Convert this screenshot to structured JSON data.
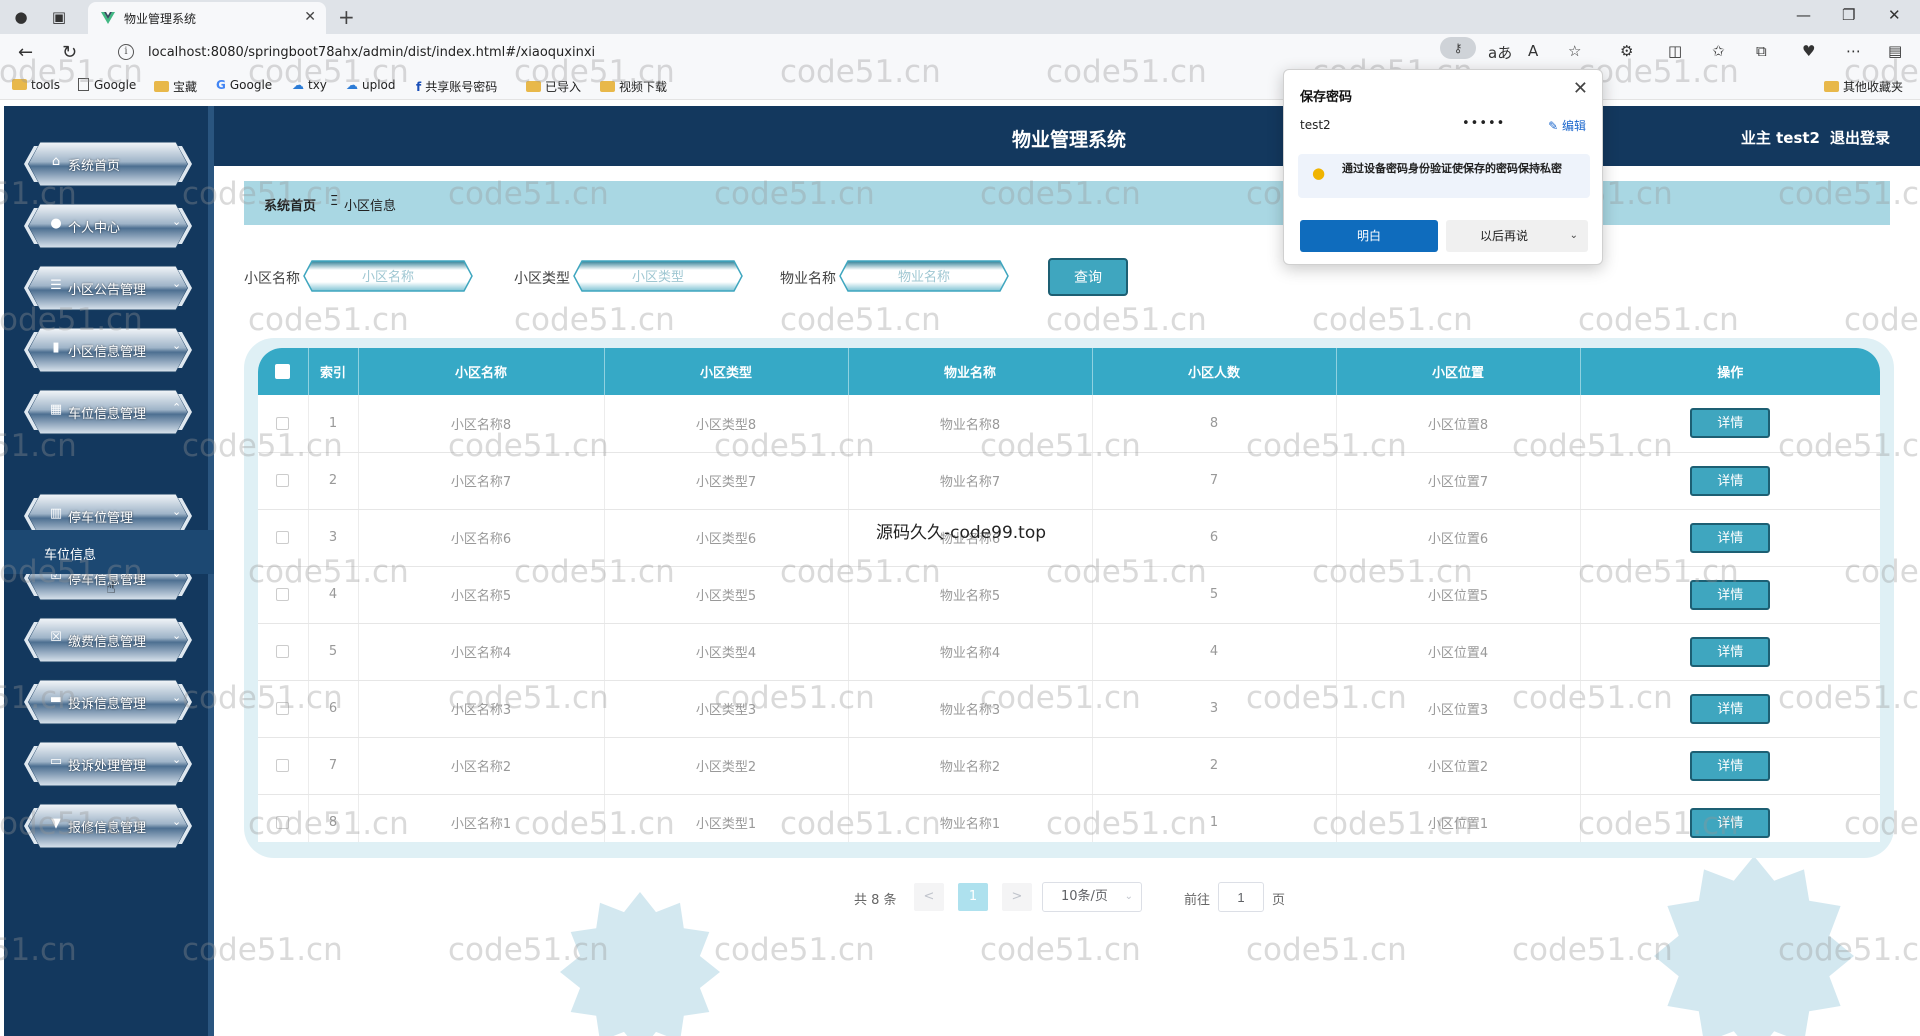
{
  "browser": {
    "tab_title": "物业管理系统",
    "url": "localhost:8080/springboot78ahx/admin/dist/index.html#/xiaoquxinxi",
    "bookmarks": [
      {
        "label": "tools",
        "type": "folder"
      },
      {
        "label": "Google",
        "type": "doc"
      },
      {
        "label": "宝藏",
        "type": "folder"
      },
      {
        "label": "Google",
        "type": "google"
      },
      {
        "label": "txy",
        "type": "cloud"
      },
      {
        "label": "uplod",
        "type": "cloud"
      },
      {
        "label": "共享账号密码",
        "type": "brand"
      },
      {
        "label": "已导入",
        "type": "folder"
      },
      {
        "label": "视频下载",
        "type": "folder"
      }
    ],
    "other_bookmarks": "其他收藏夹"
  },
  "header": {
    "title": "物业管理系统",
    "user_label": "业主 test2",
    "logout_label": "退出登录"
  },
  "sidebar": {
    "items": [
      {
        "label": "系统首页",
        "icon": "home-icon",
        "arrow": ""
      },
      {
        "label": "个人中心",
        "icon": "user-icon",
        "arrow": "⌄"
      },
      {
        "label": "小区公告管理",
        "icon": "list-icon",
        "arrow": "⌄"
      },
      {
        "label": "小区信息管理",
        "icon": "book-icon",
        "arrow": "⌄"
      },
      {
        "label": "车位信息管理",
        "icon": "grid-icon",
        "arrow": "⌃"
      },
      {
        "label": "停车位管理",
        "icon": "chart-icon",
        "arrow": "⌄"
      },
      {
        "label": "停车信息管理",
        "icon": "check-icon",
        "arrow": "⌄"
      },
      {
        "label": "缴费信息管理",
        "icon": "close-box-icon",
        "arrow": "⌄"
      },
      {
        "label": "投诉信息管理",
        "icon": "ticket-icon",
        "arrow": "⌄"
      },
      {
        "label": "投诉处理管理",
        "icon": "monitor-icon",
        "arrow": "⌄"
      },
      {
        "label": "报修信息管理",
        "icon": "tool-icon",
        "arrow": "⌄"
      }
    ],
    "submenu_label": "车位信息"
  },
  "breadcrumb": {
    "home": "系统首页",
    "separator": "Ξ",
    "current": "小区信息"
  },
  "search": {
    "name_label": "小区名称",
    "name_placeholder": "小区名称",
    "type_label": "小区类型",
    "type_placeholder": "小区类型",
    "property_label": "物业名称",
    "property_placeholder": "物业名称",
    "query_label": "查询"
  },
  "table": {
    "headers": [
      "索引",
      "小区名称",
      "小区类型",
      "物业名称",
      "小区人数",
      "小区位置",
      "操作"
    ],
    "detail_label": "详情",
    "rows": [
      {
        "index": "1",
        "name": "小区名称8",
        "type": "小区类型8",
        "property": "物业名称8",
        "people": "8",
        "location": "小区位置8"
      },
      {
        "index": "2",
        "name": "小区名称7",
        "type": "小区类型7",
        "property": "物业名称7",
        "people": "7",
        "location": "小区位置7"
      },
      {
        "index": "3",
        "name": "小区名称6",
        "type": "小区类型6",
        "property": "物业名称6",
        "people": "6",
        "location": "小区位置6"
      },
      {
        "index": "4",
        "name": "小区名称5",
        "type": "小区类型5",
        "property": "物业名称5",
        "people": "5",
        "location": "小区位置5"
      },
      {
        "index": "5",
        "name": "小区名称4",
        "type": "小区类型4",
        "property": "物业名称4",
        "people": "4",
        "location": "小区位置4"
      },
      {
        "index": "6",
        "name": "小区名称3",
        "type": "小区类型3",
        "property": "物业名称3",
        "people": "3",
        "location": "小区位置3"
      },
      {
        "index": "7",
        "name": "小区名称2",
        "type": "小区类型2",
        "property": "物业名称2",
        "people": "2",
        "location": "小区位置2"
      },
      {
        "index": "8",
        "name": "小区名称1",
        "type": "小区类型1",
        "property": "物业名称1",
        "people": "1",
        "location": "小区位置1"
      }
    ]
  },
  "pagination": {
    "total": "共 8 条",
    "prev": "<",
    "current_page": "1",
    "next": ">",
    "page_size": "10条/页",
    "goto_label": "前往",
    "goto_value": "1",
    "page_suffix": "页"
  },
  "overlay_text": "源码久久-code99.top",
  "watermark": "code51.cn",
  "password_popup": {
    "title": "保存密码",
    "username": "test2",
    "password_mask": "•••••",
    "edit_label": "编辑",
    "tip": "通过设备密码身份验证使保存的密码保持私密",
    "ok_label": "明白",
    "later_label": "以后再说"
  },
  "colors": {
    "header_bg": "#13385e",
    "accent": "#36a9c6",
    "breadcrumb_bg": "#a9d7e3",
    "button_blue": "#0f6cbd"
  }
}
